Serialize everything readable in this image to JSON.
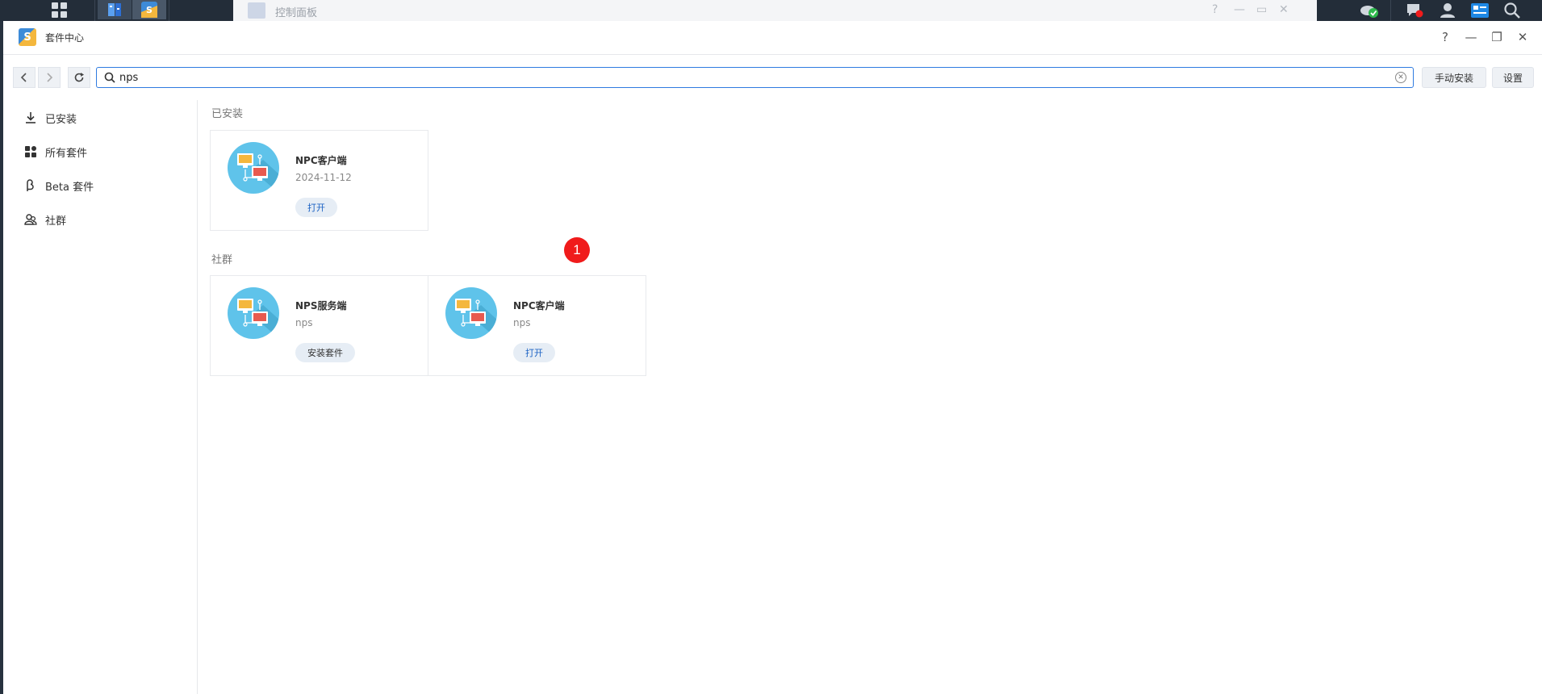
{
  "background_window": {
    "title": "控制面板"
  },
  "window": {
    "title": "套件中心"
  },
  "window_controls": {
    "help": "?",
    "minimize": "—",
    "restore": "❐",
    "close": "✕"
  },
  "toolbar": {
    "search_value": "nps",
    "manual_install_label": "手动安装",
    "settings_label": "设置"
  },
  "sidebar": {
    "items": [
      {
        "label": "已安装",
        "icon": "download-icon"
      },
      {
        "label": "所有套件",
        "icon": "grid-icon"
      },
      {
        "label": "Beta 套件",
        "icon": "beta-icon"
      },
      {
        "label": "社群",
        "icon": "community-icon"
      }
    ]
  },
  "installed": {
    "title": "已安装",
    "cards": [
      {
        "name": "NPC客户端",
        "sub": "2024-11-12",
        "button": "打开"
      }
    ]
  },
  "community": {
    "title": "社群",
    "cards": [
      {
        "name": "NPS服务端",
        "sub": "nps",
        "button": "安装套件"
      },
      {
        "name": "NPC客户端",
        "sub": "nps",
        "button": "打开"
      }
    ]
  },
  "badge": {
    "value": "1"
  },
  "colors": {
    "accent": "#2f7be0",
    "badge": "#f01b1b",
    "icon_bg": "#5fc3ea"
  }
}
